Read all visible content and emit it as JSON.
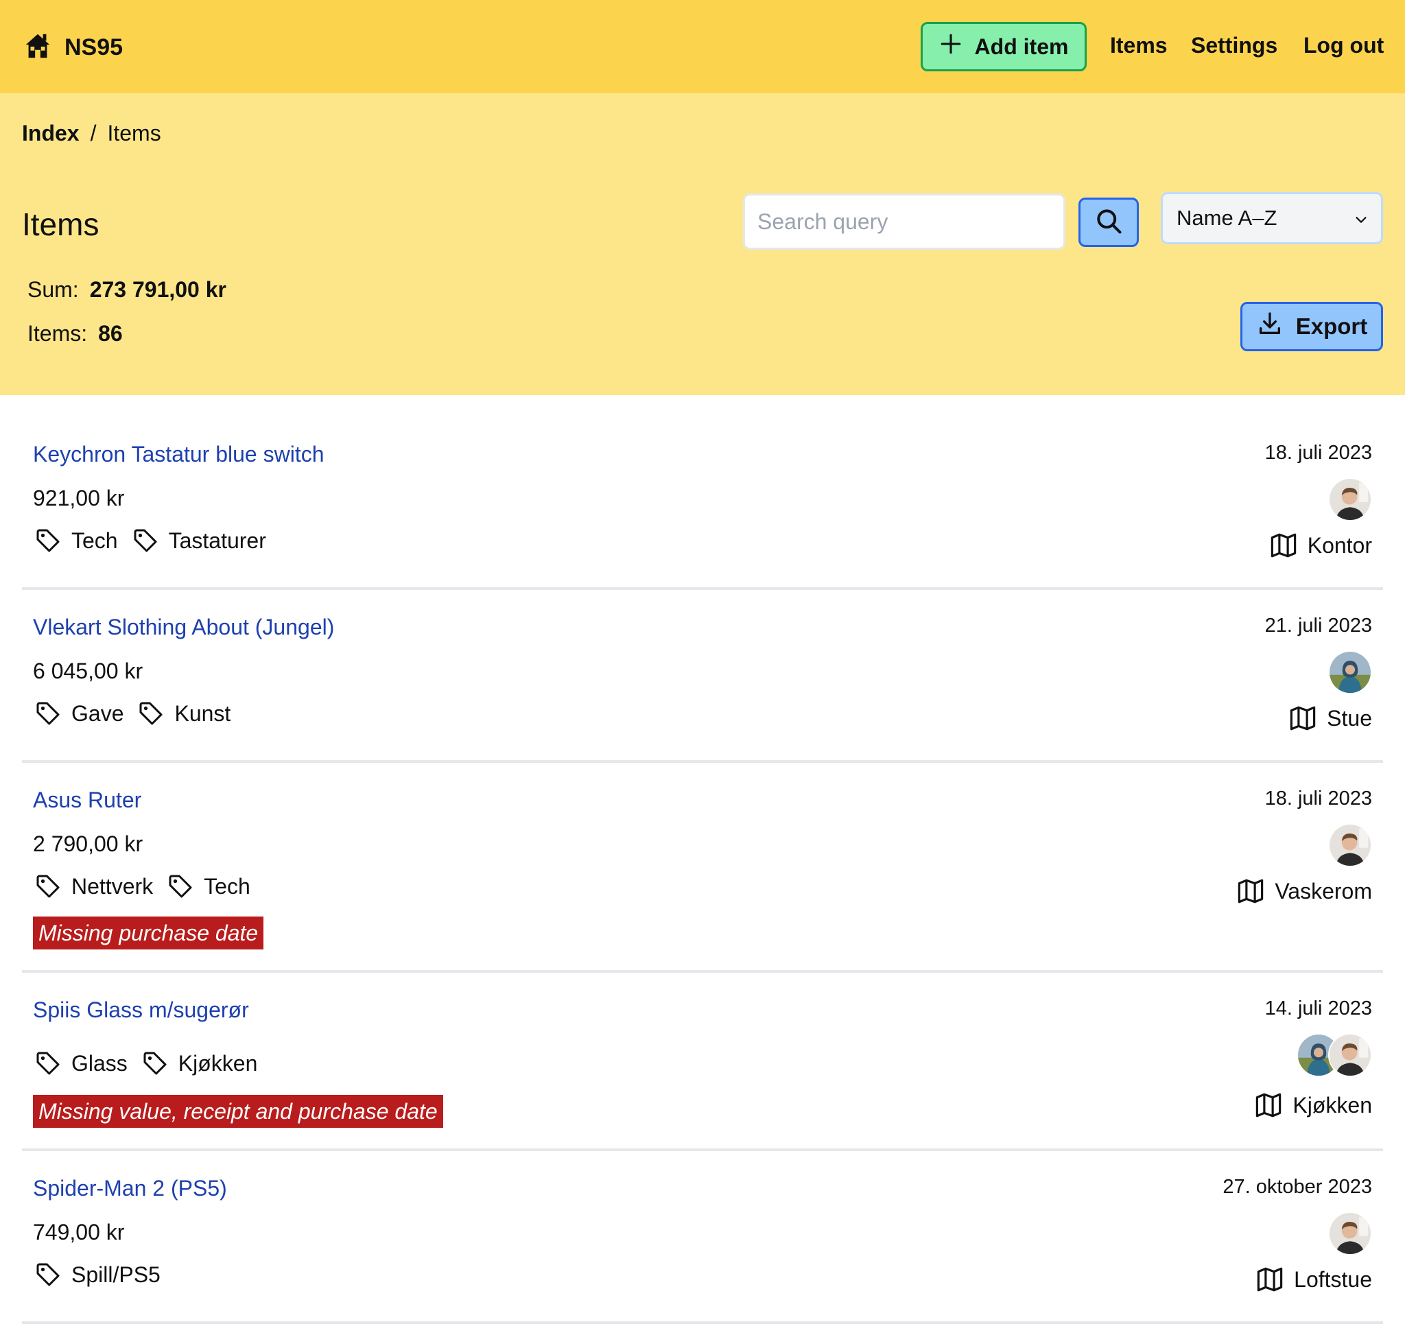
{
  "app": {
    "brand": "NS95"
  },
  "nav": {
    "add_item": "Add item",
    "items": "Items",
    "settings": "Settings",
    "logout": "Log out"
  },
  "breadcrumb": {
    "index": "Index",
    "separator": "/",
    "current": "Items"
  },
  "page": {
    "title": "Items"
  },
  "search": {
    "placeholder": "Search query",
    "value": ""
  },
  "sort": {
    "selected": "Name A–Z"
  },
  "summary": {
    "sum_label": "Sum:",
    "sum_value": "273 791,00 kr",
    "count_label": "Items:",
    "count_value": "86"
  },
  "export": {
    "label": "Export"
  },
  "items": [
    {
      "title": "Keychron Tastatur blue switch",
      "price": "921,00 kr",
      "tags": [
        "Tech",
        "Tastaturer"
      ],
      "warning": "",
      "date": "18. juli 2023",
      "owners": [
        "man"
      ],
      "location": "Kontor"
    },
    {
      "title": "Vlekart Slothing About (Jungel)",
      "price": "6 045,00 kr",
      "tags": [
        "Gave",
        "Kunst"
      ],
      "warning": "",
      "date": "21. juli 2023",
      "owners": [
        "woman"
      ],
      "location": "Stue"
    },
    {
      "title": "Asus Ruter",
      "price": "2 790,00 kr",
      "tags": [
        "Nettverk",
        "Tech"
      ],
      "warning": "Missing purchase date",
      "date": "18. juli 2023",
      "owners": [
        "man"
      ],
      "location": "Vaskerom"
    },
    {
      "title": "Spiis Glass m/sugerør",
      "price": "",
      "tags": [
        "Glass",
        "Kjøkken"
      ],
      "warning": "Missing value, receipt and purchase date",
      "date": "14. juli 2023",
      "owners": [
        "woman",
        "man"
      ],
      "location": "Kjøkken"
    },
    {
      "title": "Spider-Man 2 (PS5)",
      "price": "749,00 kr",
      "tags": [
        "Spill/PS5"
      ],
      "warning": "",
      "date": "27. oktober 2023",
      "owners": [
        "man"
      ],
      "location": "Loftstue"
    }
  ],
  "colors": {
    "nav_bg": "#fcd34d",
    "hero_bg": "#fde68a",
    "link": "#1e40af",
    "warning_bg": "#b91c1c",
    "add_bg": "#86efac",
    "primary_bg": "#93c5fd"
  },
  "icons": {
    "brand": "house-icon",
    "add": "plus-icon",
    "search": "search-icon",
    "sort": "chevron-down-icon",
    "export": "download-icon",
    "tag": "tag-icon",
    "location": "map-icon"
  }
}
